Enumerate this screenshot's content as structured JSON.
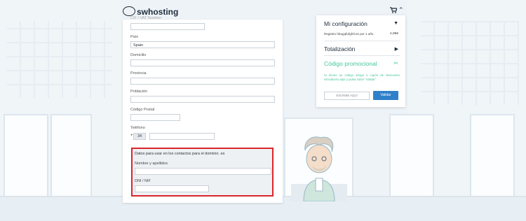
{
  "header": {
    "logo_text": "swhosting",
    "cart_icon": "cart-icon",
    "caret_icon": "chevron-up-icon"
  },
  "form": {
    "cutoff_label": "CIF / VAT Number",
    "country_label": "País",
    "country_value": "Spain",
    "address_label": "Domicilio",
    "province_label": "Provincia",
    "city_label": "Población",
    "postal_label": "Código Postal",
    "phone_label": "Teléfono",
    "phone_plus": "+",
    "phone_prefix": "34",
    "domain_section": {
      "title": "Datos para usar en los contactos para el dominio .es",
      "name_label": "Nombre y apellidos",
      "dni_label": "DNI / NIF"
    }
  },
  "cart_panel": {
    "config_title": "Mi configuración",
    "config_arrow": "▼",
    "item_text": "Registro hbugqfufghtl.es por 1 año",
    "item_price": "4,99€",
    "total_title": "Totalización",
    "total_arrow": "▶",
    "promo_title": "Código promocional",
    "promo_icon": "scissors-icon",
    "promo_text": "Si tienes un código amigo o cupón de descuento introdúcelo aquí y pulsa sobre \"validar\"",
    "promo_placeholder": "ESCRIBE AQUÍ",
    "validate_label": "Validar",
    "accent_color": "#46c49a",
    "button_color": "#2f80c9"
  },
  "highlight_color": "#d9262b"
}
